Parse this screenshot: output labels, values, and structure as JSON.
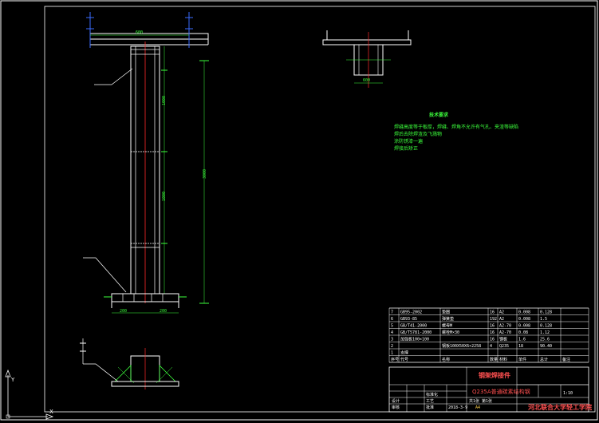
{
  "drawing": {
    "tech_title": "技术要求",
    "tech_notes": [
      "焊缝高度等于板厚，焊缝、焊角不允许有气孔、夹渣等缺陷",
      "焊后去除焊渣及飞溅物",
      "涂防锈漆一遍",
      "焊接后矫正"
    ],
    "dims_left": [
      "600",
      "1000",
      "3000",
      "1000",
      "200",
      "200"
    ],
    "dims_top": [
      "600"
    ]
  },
  "bom": {
    "rows": [
      {
        "no": "7",
        "code": "GB95-2002",
        "name": "垫圈",
        "qty": "16",
        "mat": "A2",
        "unit": "0.008",
        "total": "0.128"
      },
      {
        "no": "6",
        "code": "GB93-85",
        "name": "弹簧垫",
        "qty": "192",
        "mat": "A2",
        "unit": "0.008",
        "total": "1.5"
      },
      {
        "no": "5",
        "code": "GB/T41-2000",
        "name": "螺母M",
        "qty": "16",
        "mat": "A2-70",
        "unit": "0.008",
        "total": "0.128"
      },
      {
        "no": "4",
        "code": "GB/T5781-2000",
        "name": "螺栓M×30",
        "qty": "16",
        "mat": "A2-70",
        "unit": "0.08",
        "total": "1.12"
      },
      {
        "no": "3",
        "code": "加强板100×100",
        "name": "",
        "qty": "16",
        "mat": "钢板",
        "unit": "1.6",
        "total": "25.6"
      },
      {
        "no": "2",
        "code": "",
        "name": "钢板100X50X6×2258",
        "qty": "4",
        "mat": "Q235",
        "unit": "18",
        "total": "90.40"
      },
      {
        "no": "1",
        "code": "支撑",
        "name": "",
        "qty": "",
        "mat": "",
        "unit": "",
        "total": ""
      }
    ],
    "header": [
      "序号",
      "代号",
      "名称",
      "数量",
      "材料",
      "单件",
      "总计",
      "备注"
    ]
  },
  "title_block": {
    "title": "钢架焊接件",
    "material": "Q235A普通碳素结构钢",
    "school": "河北联合大学轻工学院",
    "scale": "1:10",
    "sheet": "共1张 第1张",
    "sheet_size": "A4",
    "labels": [
      "标记",
      "处数",
      "分区",
      "更改文件号",
      "签名",
      "年月日",
      "设计",
      "标准化",
      "审核",
      "工艺",
      "批准"
    ],
    "date": "2018-3-9"
  },
  "ucs": {
    "x_label": "X",
    "y_label": "Y"
  }
}
